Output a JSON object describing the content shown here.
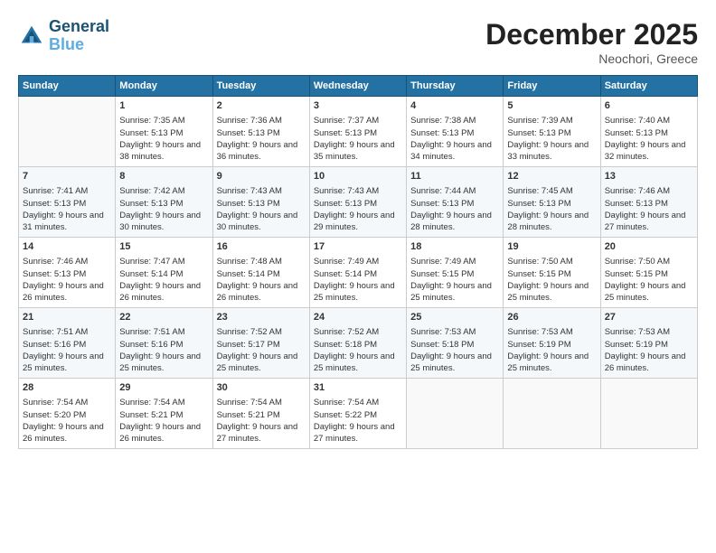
{
  "logo": {
    "line1": "General",
    "line2": "Blue"
  },
  "title": "December 2025",
  "location": "Neochori, Greece",
  "days_of_week": [
    "Sunday",
    "Monday",
    "Tuesday",
    "Wednesday",
    "Thursday",
    "Friday",
    "Saturday"
  ],
  "weeks": [
    [
      {
        "day": "",
        "empty": true
      },
      {
        "day": "1",
        "sunrise": "Sunrise: 7:35 AM",
        "sunset": "Sunset: 5:13 PM",
        "daylight": "Daylight: 9 hours and 38 minutes."
      },
      {
        "day": "2",
        "sunrise": "Sunrise: 7:36 AM",
        "sunset": "Sunset: 5:13 PM",
        "daylight": "Daylight: 9 hours and 36 minutes."
      },
      {
        "day": "3",
        "sunrise": "Sunrise: 7:37 AM",
        "sunset": "Sunset: 5:13 PM",
        "daylight": "Daylight: 9 hours and 35 minutes."
      },
      {
        "day": "4",
        "sunrise": "Sunrise: 7:38 AM",
        "sunset": "Sunset: 5:13 PM",
        "daylight": "Daylight: 9 hours and 34 minutes."
      },
      {
        "day": "5",
        "sunrise": "Sunrise: 7:39 AM",
        "sunset": "Sunset: 5:13 PM",
        "daylight": "Daylight: 9 hours and 33 minutes."
      },
      {
        "day": "6",
        "sunrise": "Sunrise: 7:40 AM",
        "sunset": "Sunset: 5:13 PM",
        "daylight": "Daylight: 9 hours and 32 minutes."
      }
    ],
    [
      {
        "day": "7",
        "sunrise": "Sunrise: 7:41 AM",
        "sunset": "Sunset: 5:13 PM",
        "daylight": "Daylight: 9 hours and 31 minutes."
      },
      {
        "day": "8",
        "sunrise": "Sunrise: 7:42 AM",
        "sunset": "Sunset: 5:13 PM",
        "daylight": "Daylight: 9 hours and 30 minutes."
      },
      {
        "day": "9",
        "sunrise": "Sunrise: 7:43 AM",
        "sunset": "Sunset: 5:13 PM",
        "daylight": "Daylight: 9 hours and 30 minutes."
      },
      {
        "day": "10",
        "sunrise": "Sunrise: 7:43 AM",
        "sunset": "Sunset: 5:13 PM",
        "daylight": "Daylight: 9 hours and 29 minutes."
      },
      {
        "day": "11",
        "sunrise": "Sunrise: 7:44 AM",
        "sunset": "Sunset: 5:13 PM",
        "daylight": "Daylight: 9 hours and 28 minutes."
      },
      {
        "day": "12",
        "sunrise": "Sunrise: 7:45 AM",
        "sunset": "Sunset: 5:13 PM",
        "daylight": "Daylight: 9 hours and 28 minutes."
      },
      {
        "day": "13",
        "sunrise": "Sunrise: 7:46 AM",
        "sunset": "Sunset: 5:13 PM",
        "daylight": "Daylight: 9 hours and 27 minutes."
      }
    ],
    [
      {
        "day": "14",
        "sunrise": "Sunrise: 7:46 AM",
        "sunset": "Sunset: 5:13 PM",
        "daylight": "Daylight: 9 hours and 26 minutes."
      },
      {
        "day": "15",
        "sunrise": "Sunrise: 7:47 AM",
        "sunset": "Sunset: 5:14 PM",
        "daylight": "Daylight: 9 hours and 26 minutes."
      },
      {
        "day": "16",
        "sunrise": "Sunrise: 7:48 AM",
        "sunset": "Sunset: 5:14 PM",
        "daylight": "Daylight: 9 hours and 26 minutes."
      },
      {
        "day": "17",
        "sunrise": "Sunrise: 7:49 AM",
        "sunset": "Sunset: 5:14 PM",
        "daylight": "Daylight: 9 hours and 25 minutes."
      },
      {
        "day": "18",
        "sunrise": "Sunrise: 7:49 AM",
        "sunset": "Sunset: 5:15 PM",
        "daylight": "Daylight: 9 hours and 25 minutes."
      },
      {
        "day": "19",
        "sunrise": "Sunrise: 7:50 AM",
        "sunset": "Sunset: 5:15 PM",
        "daylight": "Daylight: 9 hours and 25 minutes."
      },
      {
        "day": "20",
        "sunrise": "Sunrise: 7:50 AM",
        "sunset": "Sunset: 5:15 PM",
        "daylight": "Daylight: 9 hours and 25 minutes."
      }
    ],
    [
      {
        "day": "21",
        "sunrise": "Sunrise: 7:51 AM",
        "sunset": "Sunset: 5:16 PM",
        "daylight": "Daylight: 9 hours and 25 minutes."
      },
      {
        "day": "22",
        "sunrise": "Sunrise: 7:51 AM",
        "sunset": "Sunset: 5:16 PM",
        "daylight": "Daylight: 9 hours and 25 minutes."
      },
      {
        "day": "23",
        "sunrise": "Sunrise: 7:52 AM",
        "sunset": "Sunset: 5:17 PM",
        "daylight": "Daylight: 9 hours and 25 minutes."
      },
      {
        "day": "24",
        "sunrise": "Sunrise: 7:52 AM",
        "sunset": "Sunset: 5:18 PM",
        "daylight": "Daylight: 9 hours and 25 minutes."
      },
      {
        "day": "25",
        "sunrise": "Sunrise: 7:53 AM",
        "sunset": "Sunset: 5:18 PM",
        "daylight": "Daylight: 9 hours and 25 minutes."
      },
      {
        "day": "26",
        "sunrise": "Sunrise: 7:53 AM",
        "sunset": "Sunset: 5:19 PM",
        "daylight": "Daylight: 9 hours and 25 minutes."
      },
      {
        "day": "27",
        "sunrise": "Sunrise: 7:53 AM",
        "sunset": "Sunset: 5:19 PM",
        "daylight": "Daylight: 9 hours and 26 minutes."
      }
    ],
    [
      {
        "day": "28",
        "sunrise": "Sunrise: 7:54 AM",
        "sunset": "Sunset: 5:20 PM",
        "daylight": "Daylight: 9 hours and 26 minutes."
      },
      {
        "day": "29",
        "sunrise": "Sunrise: 7:54 AM",
        "sunset": "Sunset: 5:21 PM",
        "daylight": "Daylight: 9 hours and 26 minutes."
      },
      {
        "day": "30",
        "sunrise": "Sunrise: 7:54 AM",
        "sunset": "Sunset: 5:21 PM",
        "daylight": "Daylight: 9 hours and 27 minutes."
      },
      {
        "day": "31",
        "sunrise": "Sunrise: 7:54 AM",
        "sunset": "Sunset: 5:22 PM",
        "daylight": "Daylight: 9 hours and 27 minutes."
      },
      {
        "day": "",
        "empty": true
      },
      {
        "day": "",
        "empty": true
      },
      {
        "day": "",
        "empty": true
      }
    ]
  ]
}
